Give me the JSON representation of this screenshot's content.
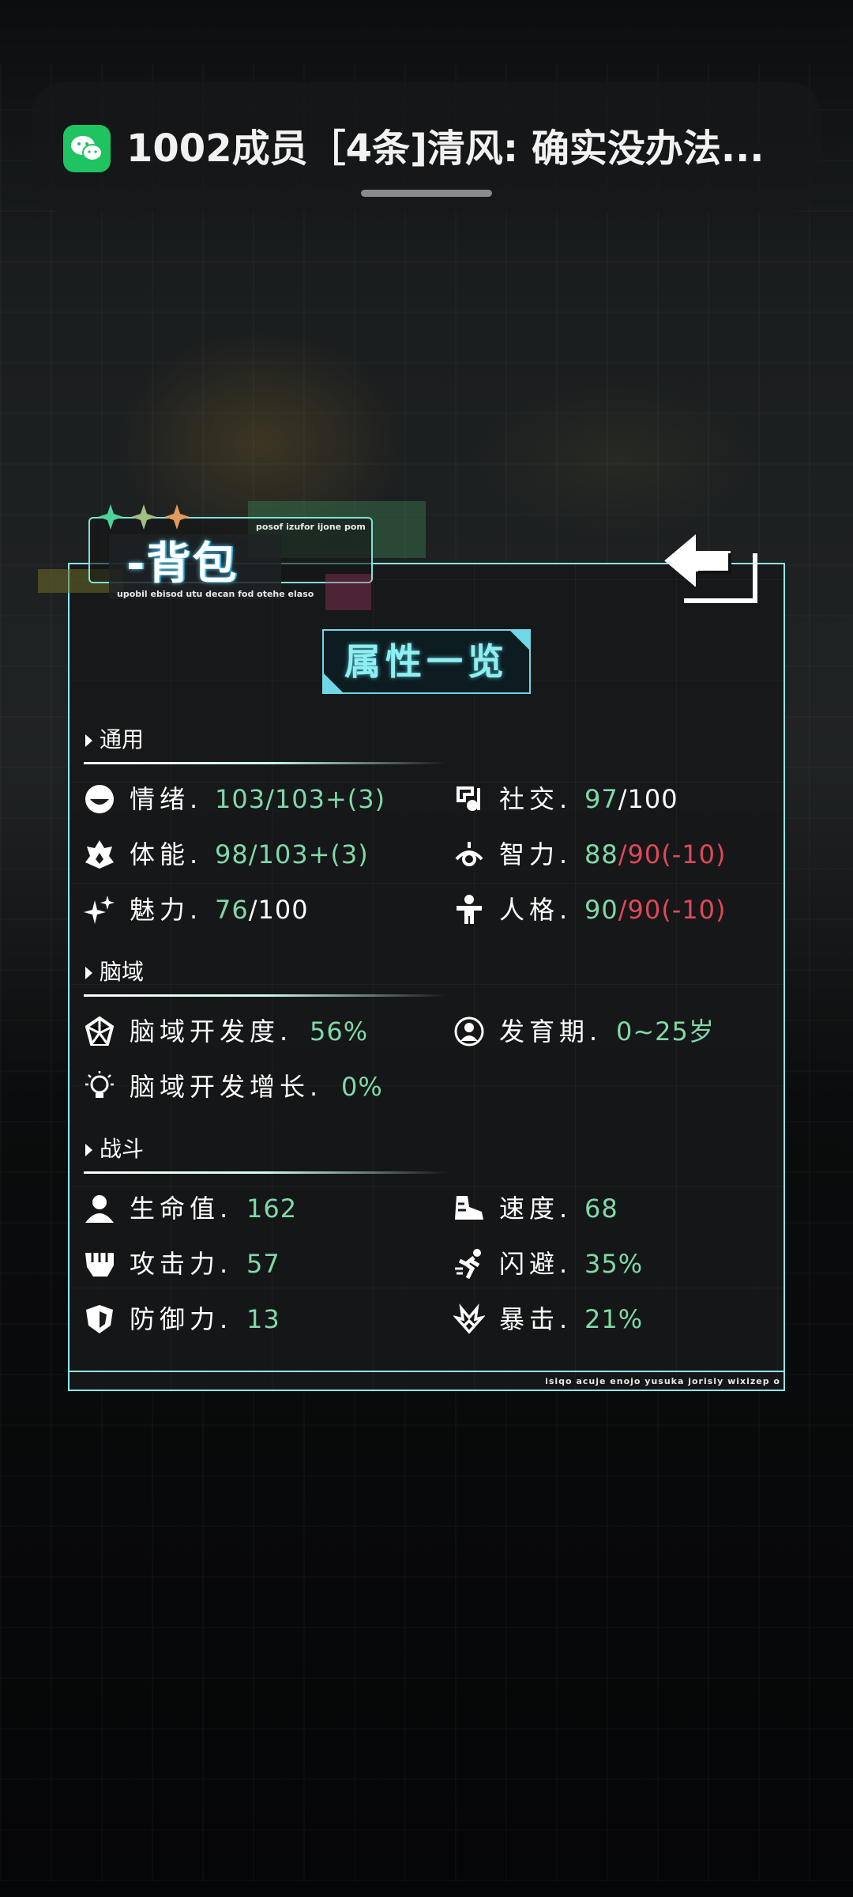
{
  "notification": {
    "app_icon": "wechat-icon",
    "text": "1002成员［4条]清风: 确实没办法..."
  },
  "header": {
    "title": "-背包",
    "sub_top": "posof izufor ijone pom",
    "sub_bottom": "upobil ebisod utu decan fod otehe elaso",
    "back_icon": "back-arrow-icon"
  },
  "panel": {
    "title": "属性一览",
    "footer_text": "isiqo acuje enojo yusuka jorisiy wixizep o"
  },
  "sections": {
    "general": "通用",
    "brain": "脑域",
    "combat": "战斗"
  },
  "stats": {
    "mood": {
      "name": "情绪.",
      "value": "103/103+(3)",
      "icon": "smile-face-icon"
    },
    "social": {
      "name": "社交.",
      "v1": "97",
      "v2": "/100",
      "icon": "social-icon"
    },
    "stamina": {
      "name": "体能.",
      "value": "98/103+(3)",
      "icon": "fire-strength-icon"
    },
    "intellect": {
      "name": "智力.",
      "v1": "88",
      "v2": "/90(-10)",
      "icon": "eye-brain-icon"
    },
    "charm": {
      "name": "魅力.",
      "v1": "76",
      "v2": "/100",
      "icon": "sparkle-icon"
    },
    "personality": {
      "name": "人格.",
      "v1": "90",
      "v2": "/90(-10)",
      "icon": "person-icon"
    },
    "brain_dev": {
      "name": "脑域开发度.",
      "value": "56%",
      "icon": "brain-network-icon"
    },
    "growth_period": {
      "name": "发育期.",
      "value": "0~25岁",
      "icon": "head-profile-icon"
    },
    "brain_growth": {
      "name": "脑域开发增长.",
      "value": "0%",
      "icon": "lightbulb-icon"
    },
    "hp": {
      "name": "生命值.",
      "value": "162",
      "icon": "user-icon"
    },
    "speed": {
      "name": "速度.",
      "value": "68",
      "icon": "speed-shoe-icon"
    },
    "attack": {
      "name": "攻击力.",
      "value": "57",
      "icon": "fist-icon"
    },
    "dodge": {
      "name": "闪避.",
      "value": "35%",
      "icon": "running-man-icon"
    },
    "defense": {
      "name": "防御力.",
      "value": "13",
      "icon": "shield-icon"
    },
    "crit": {
      "name": "暴击.",
      "value": "21%",
      "icon": "burst-icon"
    }
  },
  "colors": {
    "accent_cyan": "#8ee6ee",
    "value_green": "#7fd9a8",
    "value_red": "#e0485a",
    "wechat_green": "#1fc461"
  }
}
